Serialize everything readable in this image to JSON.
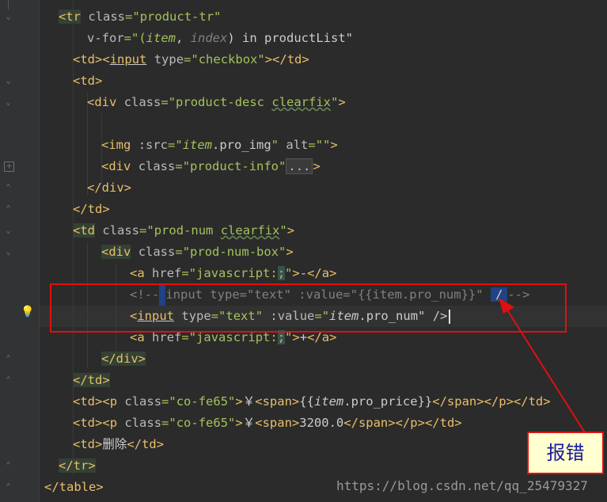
{
  "code_lines": [
    {
      "indent": 4,
      "html": "tr_open"
    },
    {
      "indent": 6,
      "html": "vfor"
    },
    {
      "indent": 5,
      "html": "td_checkbox"
    },
    {
      "indent": 5,
      "html": "td_open"
    },
    {
      "indent": 6,
      "html": "div_desc"
    },
    {
      "indent": 0,
      "html": "blank"
    },
    {
      "indent": 7,
      "html": "img"
    },
    {
      "indent": 7,
      "html": "div_info"
    },
    {
      "indent": 6,
      "html": "div_close"
    },
    {
      "indent": 5,
      "html": "td_close"
    },
    {
      "indent": 5,
      "html": "td_prodnum"
    },
    {
      "indent": 6,
      "html": "div_numbox"
    },
    {
      "indent": 7,
      "html": "a_minus"
    },
    {
      "indent": 7,
      "html": "comment_input"
    },
    {
      "indent": 7,
      "html": "input_text"
    },
    {
      "indent": 7,
      "html": "a_plus"
    },
    {
      "indent": 6,
      "html": "div_close2"
    },
    {
      "indent": 5,
      "html": "td_close2"
    },
    {
      "indent": 5,
      "html": "td_price"
    },
    {
      "indent": 5,
      "html": "td_total"
    },
    {
      "indent": 5,
      "html": "td_delete"
    },
    {
      "indent": 4,
      "html": "tr_close"
    },
    {
      "indent": 3,
      "html": "table_close"
    }
  ],
  "text": {
    "tr_tag": "tr",
    "class_attr": "class",
    "tr_class_val": "\"product-tr\"",
    "vfor_attr": "v-for",
    "vfor_val_open": "=\"(",
    "vfor_item": "item",
    "vfor_comma": ", ",
    "vfor_index": "index",
    "vfor_rest": ") in productList\"",
    "td_tag": "td",
    "input_tag": "input",
    "type_attr": "type",
    "checkbox_val": "\"checkbox\"",
    "div_tag": "div",
    "desc_val_a": "\"product-desc ",
    "desc_val_b": "clearfix",
    "img_tag": "img",
    "src_attr": ":src",
    "img_item": "item",
    "img_pro": ".pro_img",
    "alt_attr": "alt",
    "alt_val": "\"\"",
    "info_val": "\"product-info\"",
    "fold_dots": "...",
    "prodnum_val_a": "\"prod-num ",
    "prodnum_val_b": "clearfix",
    "numbox_val": "\"prod-num-box\"",
    "a_tag": "a",
    "href_attr": "href",
    "href_val_a": "\"javascript:",
    "href_semi": ";",
    "minus": "-",
    "plus": "+",
    "comment_open": "<!--",
    "comment_body": "input type=\"text\" :value=\"{{item.pro_num}}\" ",
    "comment_slash": "/",
    "comment_close": "-->",
    "text_val": "\"text\"",
    "value_attr": ":value",
    "input_item": "item",
    "input_pro": ".pro_num\"",
    "input_end": " />",
    "p_tag": "p",
    "co_val": "\"co-fe65\"",
    "yen": "￥",
    "span_tag": "span",
    "price_open": "{{",
    "price_item": "item",
    "price_rest": ".pro_price}}",
    "total": "3200.0",
    "delete_text": "删除",
    "table_tag": "table"
  },
  "callout_label": "报错",
  "watermark": "https://blog.csdn.net/qq_25479327",
  "colors": {
    "background": "#2b2b2b",
    "tag": "#e8bf6a",
    "attribute": "#bababa",
    "string": "#a5c25c",
    "comment": "#808080",
    "annotation_red": "#e01010",
    "callout_bg": "#ffffd0"
  },
  "icons": [
    "fold-marker-icon",
    "lightbulb-icon",
    "arrow-icon"
  ]
}
